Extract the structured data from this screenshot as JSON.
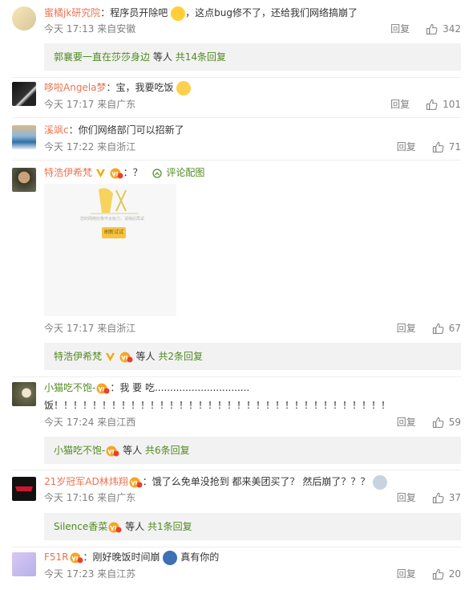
{
  "comments": [
    {
      "user": "蜜橘jk研究院",
      "text": "：程序员开除吧",
      "text_after": "，这点bug修不了，还给我们网络搞崩了",
      "time": "今天 17:13",
      "location": "来自安徽",
      "reply_label": "回复",
      "likes": "342",
      "thread": {
        "user": "郭襄要一直在莎莎身边",
        "etc": "等人",
        "count": "共14条回复"
      }
    },
    {
      "user": "哆啦Angela梦",
      "text": "：宝，我要吃饭",
      "time": "今天 17:17",
      "location": "来自广东",
      "reply_label": "回复",
      "likes": "101"
    },
    {
      "user": "溪飒c",
      "text": "：你们网络部门可以招新了",
      "time": "今天 17:22",
      "location": "来自浙江",
      "reply_label": "回复",
      "likes": "71"
    },
    {
      "user": "特浩伊希梵",
      "text": "：？",
      "pic_label": "评论配图",
      "image_text": "您的网络好像不太给力，请稍后再试",
      "image_button": "刷新试试",
      "time": "今天 17:17",
      "location": "来自浙江",
      "reply_label": "回复",
      "likes": "67",
      "thread": {
        "user": "特浩伊希梵",
        "etc": "等人",
        "count": "共2条回复"
      }
    },
    {
      "user": "小猫吃不饱-",
      "text": "：我 要 吃...............................",
      "text2": "饭！！！！！！！！！！！！！！！！！！！！！！！！！！！！！！！！！！！",
      "time": "今天 17:24",
      "location": "来自江西",
      "reply_label": "回复",
      "likes": "59",
      "thread": {
        "user": "小猫吃不饱-",
        "etc": "等人",
        "count": "共6条回复"
      }
    },
    {
      "user": "21岁冠军AD林炜翔",
      "text": "：饿了么免单没抢到 都来美团买了？ 然后崩了？？？",
      "time": "今天 17:16",
      "location": "来自广东",
      "reply_label": "回复",
      "likes": "37",
      "thread": {
        "user": "Silence香菜",
        "etc": "等人",
        "count": "共1条回复"
      }
    },
    {
      "user": "F51R",
      "text": "：刚好晚饭时间崩",
      "text_after": "真有你的",
      "time": "今天 17:23",
      "location": "来自江苏",
      "reply_label": "回复",
      "likes": "20"
    }
  ],
  "colors": {
    "username": "#eb7350",
    "link_green": "#508b20",
    "meta": "#808080",
    "thread_bg": "#f2f2f2"
  },
  "icons": {
    "like": "thumbs-up-icon",
    "vip": "vip-badge-icon",
    "verified": "verified-v-icon",
    "emoji": "emoji-icon",
    "picture": "picture-icon"
  }
}
